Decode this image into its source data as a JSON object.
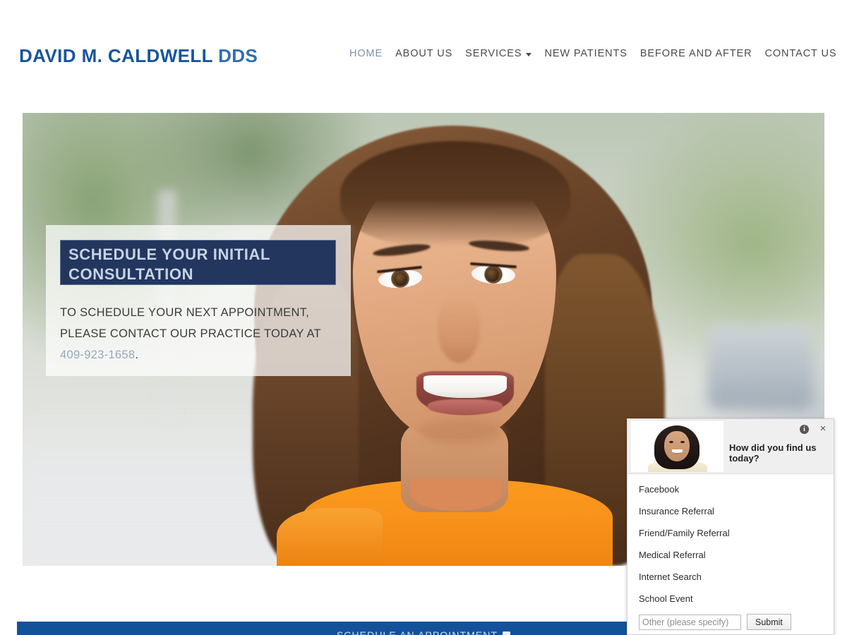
{
  "header": {
    "logo_main": "DAVID M. CALDWELL",
    "logo_suffix": " DDS",
    "nav": [
      {
        "label": "HOME",
        "active": true
      },
      {
        "label": "ABOUT US",
        "active": false
      },
      {
        "label": "SERVICES",
        "active": false,
        "has_dropdown": true
      },
      {
        "label": "NEW PATIENTS",
        "active": false
      },
      {
        "label": "BEFORE AND AFTER",
        "active": false
      },
      {
        "label": "CONTACT US",
        "active": false
      }
    ]
  },
  "hero": {
    "headline": "SCHEDULE YOUR INITIAL CONSULTATION",
    "body_line1": "TO SCHEDULE YOUR NEXT APPOINTMENT,",
    "body_line2": "PLEASE CONTACT OUR PRACTICE TODAY AT",
    "phone": "409-923-1658",
    "phone_period": ".",
    "image_alt": "smiling-woman-orange-top",
    "headline_bg": "#23365e",
    "headline_color": "#c6d3e4",
    "phone_color": "#93a8bf"
  },
  "cta_bar": {
    "label": "SCHEDULE AN APPOINTMENT",
    "color": "#14519b"
  },
  "survey": {
    "question": "How did you find us today?",
    "avatar_alt": "staff-member-photo",
    "info_icon": "i",
    "close_icon": "×",
    "options": [
      "Facebook",
      "Insurance Referral",
      "Friend/Family Referral",
      "Medical Referral",
      "Internet Search",
      "School Event"
    ],
    "other_placeholder": "Other (please specify)",
    "other_value": "",
    "submit_label": "Submit"
  }
}
